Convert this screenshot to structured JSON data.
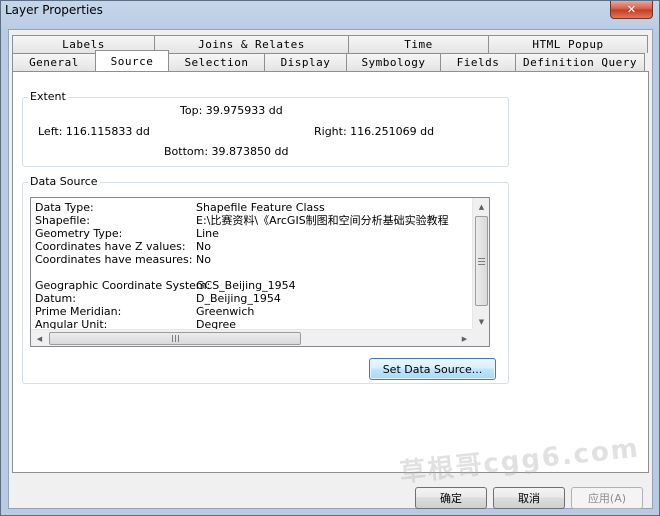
{
  "window": {
    "title": "Layer Properties",
    "close_glyph": "✕"
  },
  "tabs": {
    "back_row": [
      "Labels",
      "Joins & Relates",
      "Time",
      "HTML Popup"
    ],
    "front_row": [
      "General",
      "Source",
      "Selection",
      "Display",
      "Symbology",
      "Fields",
      "Definition Query"
    ],
    "active": "Source"
  },
  "extent": {
    "title": "Extent",
    "top": "Top:  39.975933 dd",
    "left": "Left:  116.115833 dd",
    "right": "Right:  116.251069 dd",
    "bottom": "Bottom:  39.873850 dd"
  },
  "data_source": {
    "title": "Data Source",
    "rows": [
      {
        "key": "Data Type:",
        "value": "Shapefile Feature Class"
      },
      {
        "key": "Shapefile:",
        "value": "E:\\比赛资料\\《ArcGIS制图和空间分析基础实验教程"
      },
      {
        "key": "Geometry Type:",
        "value": "Line"
      },
      {
        "key": "Coordinates have Z values:",
        "value": "No"
      },
      {
        "key": "Coordinates have measures:",
        "value": "No"
      },
      {
        "key": "",
        "value": ""
      },
      {
        "key": "Geographic Coordinate System:",
        "value": "GCS_Beijing_1954"
      },
      {
        "key": "Datum:",
        "value": "D_Beijing_1954"
      },
      {
        "key": "Prime Meridian:",
        "value": "Greenwich"
      },
      {
        "key": "Angular Unit:",
        "value": "Degree"
      }
    ],
    "scroll_glyphs": {
      "up": "▲",
      "down": "▼",
      "left": "◀",
      "right": "▶"
    },
    "set_button": "Set Data Source..."
  },
  "footer": {
    "ok": "确定",
    "cancel": "取消",
    "apply": "应用(A)"
  },
  "watermark": "草根哥cgg6.com",
  "colors": {
    "accent": "#3c7fb1",
    "close": "#c43a22",
    "frame": "#c5d5ea"
  }
}
